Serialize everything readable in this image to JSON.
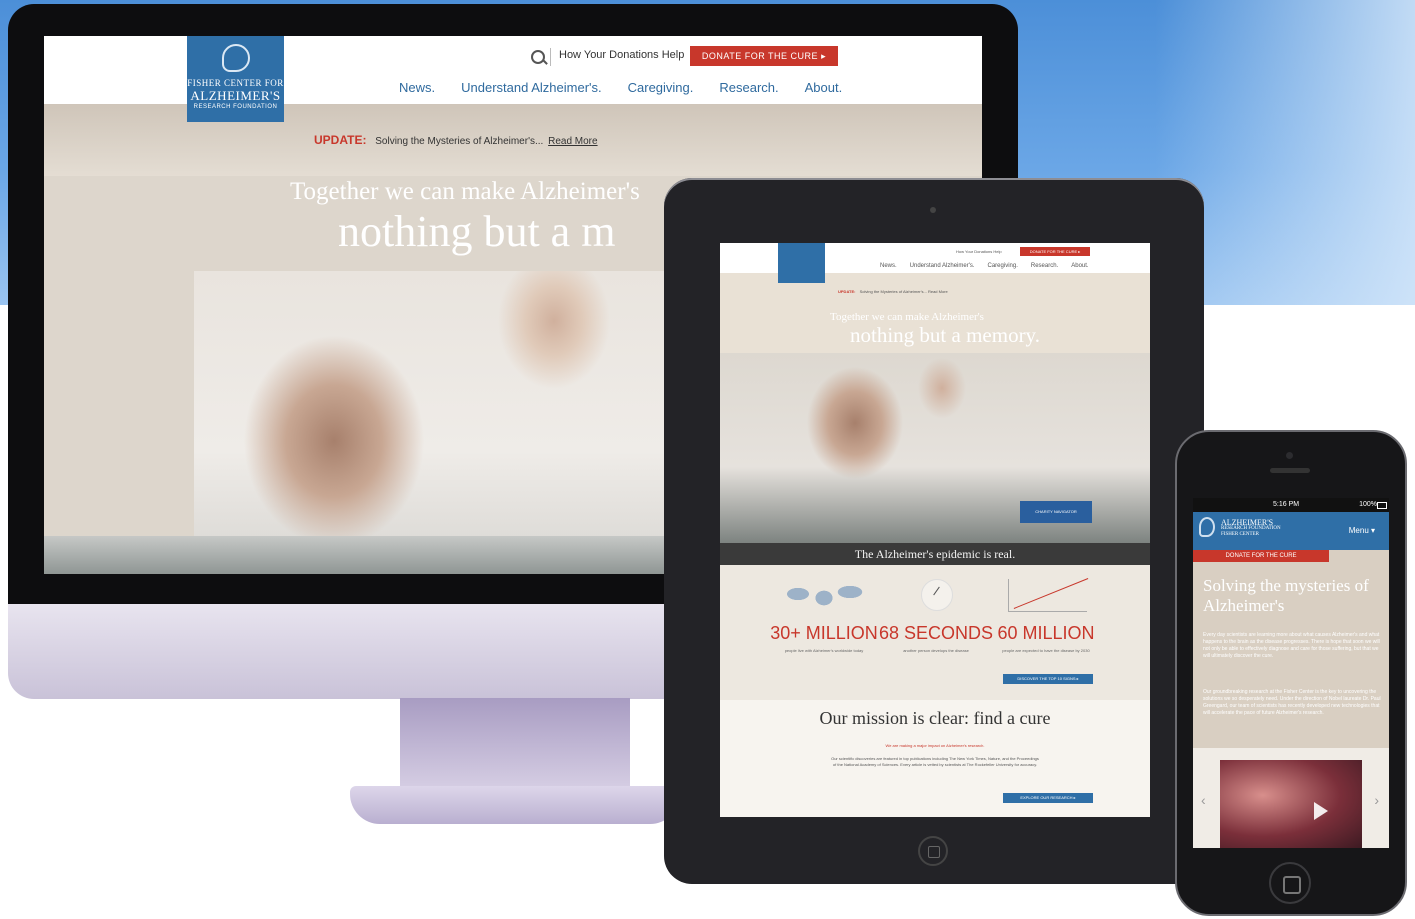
{
  "desktop": {
    "logo": {
      "line1": "FISHER CENTER FOR",
      "line2": "ALZHEIMER'S",
      "line3": "RESEARCH FOUNDATION"
    },
    "header": {
      "donations_link": "How Your Donations Help",
      "donate_button": "DONATE FOR THE CURE ▸"
    },
    "nav": [
      "News.",
      "Understand Alzheimer's.",
      "Caregiving.",
      "Research.",
      "About."
    ],
    "update": {
      "label": "UPDATE:",
      "text": "Solving the Mysteries of Alzheimer's...",
      "link": "Read More"
    },
    "hero": {
      "line1": "Together we can make Alzheimer's",
      "line2": "nothing but a m"
    }
  },
  "tablet": {
    "header": {
      "donations_link": "How Your Donations Help",
      "donate_button": "DONATE FOR THE CURE ▸"
    },
    "nav": [
      "News.",
      "Understand Alzheimer's.",
      "Caregiving.",
      "Research.",
      "About."
    ],
    "update": {
      "label": "UPDATE:",
      "text": "Solving the Mysteries of Alzheimer's... Read More"
    },
    "hero": {
      "line1": "Together we can make Alzheimer's",
      "line2": "nothing but a memory."
    },
    "charity_badge": "CHARITY NAVIGATOR",
    "caption": "The Alzheimer's epidemic is real.",
    "stats": [
      {
        "value": "30+ MILLION",
        "desc": "people live with Alzheimer's worldwide today"
      },
      {
        "value": "68 SECONDS",
        "desc": "another person develops the disease"
      },
      {
        "value": "60 MILLION",
        "desc": "people are expected to have the disease by 2030"
      }
    ],
    "discover_button": "DISCOVER THE TOP 10 SIGNS ▸",
    "mission": {
      "title": "Our mission is clear: find a cure",
      "subtitle": "We are making a major impact on Alzheimer's research.",
      "paragraph": "Our scientific discoveries are featured in top publications including The New York Times, Nature, and the Proceedings of the National Academy of Sciences. Every article is vetted by scientists at The Rockefeller University for accuracy.",
      "button": "EXPLORE OUR RESEARCH ▸"
    }
  },
  "phone": {
    "status": {
      "time": "5:16 PM",
      "battery": "100%"
    },
    "logo": {
      "line1": "ALZHEIMER'S",
      "line2": "RESEARCH FOUNDATION",
      "line3": "FISHER CENTER"
    },
    "menu": "Menu ▾",
    "donate_button": "DONATE FOR THE CURE",
    "title": "Solving the mysteries of Alzheimer's",
    "para1": "Every day scientists are learning more about what causes Alzheimer's and what happens to the brain as the disease progresses. There is hope that soon we will not only be able to effectively diagnose and care for those suffering, but that we will ultimately discover the cure.",
    "para2": "Our groundbreaking research at the Fisher Center is the key to uncovering the solutions we so desperately need. Under the direction of Nobel laureate Dr. Paul Greengard, our team of scientists has recently developed new technologies that will accelerate the pace of future Alzheimer's research.",
    "carousel": {
      "prev": "‹",
      "next": "›"
    }
  }
}
